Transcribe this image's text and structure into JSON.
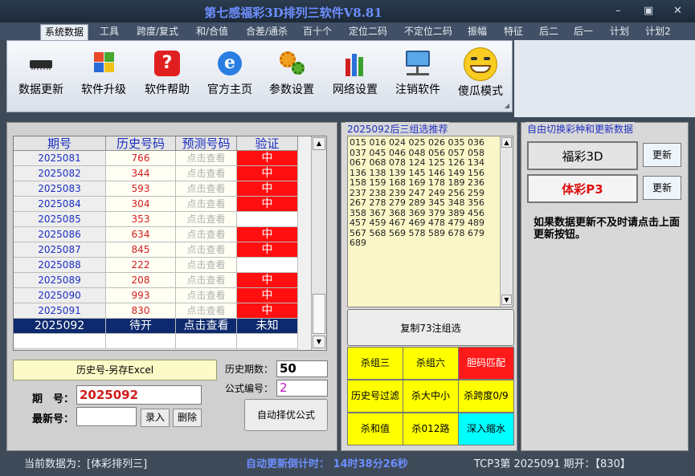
{
  "window": {
    "title": "第七感福彩3D排列三软件V8.81",
    "min_glyph": "–",
    "max_glyph": "▣",
    "close_glyph": "✕"
  },
  "menu": {
    "tabs": [
      "系统数据",
      "工具",
      "跨度/复式",
      "和/合值",
      "合差/通杀",
      "百十个",
      "定位二码",
      "不定位二码",
      "振幅",
      "特征",
      "后二",
      "后一",
      "计划",
      "计划2"
    ]
  },
  "toolbar": {
    "buttons": [
      "数据更新",
      "软件升级",
      "软件帮助",
      "官方主页",
      "参数设置",
      "网络设置",
      "注销软件",
      "傻瓜模式"
    ],
    "help_glyph": "?",
    "ie_glyph": "e"
  },
  "grid": {
    "headers": [
      "期号",
      "历史号码",
      "预测号码",
      "验证"
    ],
    "rows": [
      {
        "period": "2025081",
        "history": "766",
        "predict": "点击查看",
        "verify": "中"
      },
      {
        "period": "2025082",
        "history": "344",
        "predict": "点击查看",
        "verify": "中"
      },
      {
        "period": "2025083",
        "history": "593",
        "predict": "点击查看",
        "verify": "中"
      },
      {
        "period": "2025084",
        "history": "304",
        "predict": "点击查看",
        "verify": "中"
      },
      {
        "period": "2025085",
        "history": "353",
        "predict": "点击查看",
        "verify": ""
      },
      {
        "period": "2025086",
        "history": "634",
        "predict": "点击查看",
        "verify": "中"
      },
      {
        "period": "2025087",
        "history": "845",
        "predict": "点击查看",
        "verify": "中"
      },
      {
        "period": "2025088",
        "history": "222",
        "predict": "点击查看",
        "verify": ""
      },
      {
        "period": "2025089",
        "history": "208",
        "predict": "点击查看",
        "verify": "中"
      },
      {
        "period": "2025090",
        "history": "993",
        "predict": "点击查看",
        "verify": "中"
      },
      {
        "period": "2025091",
        "history": "830",
        "predict": "点击查看",
        "verify": "中"
      },
      {
        "period": "2025092",
        "history": "待开",
        "predict": "点击查看",
        "verify": "未知"
      }
    ]
  },
  "left": {
    "export_btn": "历史号-另存Excel",
    "period_label": "期　号：",
    "period_value": "2025092",
    "newest_label": "最新号：",
    "newest_value": "",
    "enter_btn": "录入",
    "delete_btn": "删除",
    "history_count_label": "历史期数：",
    "history_count_value": "50",
    "formula_label": "公式编号：",
    "formula_value": "2",
    "auto_btn": "自动择优公式"
  },
  "middle": {
    "title": "2025092后三组选推荐",
    "numbers": "015 016 024 025 026 035 036 037 045 046 048 056 057 058 067 068 078 124 125 126 134 136 138 139 145 146 149 156 158 159 168 169 178 189 236 237 238 239 247 249 256 259 267 278 279 289 345 348 356 358 367 368 369 379 389 456 457 459 467 469 478 479 489 567 568 569 578 589 678 679 689",
    "copy_btn": "复制73注组选",
    "buttons": [
      {
        "label": "杀组三",
        "color": "#ffff00",
        "text": "#000000"
      },
      {
        "label": "杀组六",
        "color": "#ffff00",
        "text": "#000000"
      },
      {
        "label": "胆码匹配",
        "color": "#ff1a1a",
        "text": "#ffffff"
      },
      {
        "label": "历史号过滤",
        "color": "#ffff00",
        "text": "#000000"
      },
      {
        "label": "杀大中小",
        "color": "#ffff00",
        "text": "#000000"
      },
      {
        "label": "杀跨度0/9",
        "color": "#ffff00",
        "text": "#000000"
      },
      {
        "label": "杀和值",
        "color": "#ffff00",
        "text": "#000000"
      },
      {
        "label": "杀012路",
        "color": "#ffff00",
        "text": "#000000"
      },
      {
        "label": "深入缩水",
        "color": "#00ffff",
        "text": "#000000"
      }
    ]
  },
  "right": {
    "title": "自由切换彩种和更新数据",
    "fc3d": "福彩3D",
    "p3": "体彩P3",
    "update": "更新",
    "note": "如果数据更新不及时请点击上面更新按钮。"
  },
  "status": {
    "current": "当前数据为：[体彩排列三]",
    "countdown": "自动更新倒计时： 14时38分26秒",
    "draw": "TCP3第 2025091 期开：【830】"
  },
  "colors": {
    "hit": "#ff0f0f",
    "row_blue": "#0e2a6e",
    "accent": "#2030c0"
  }
}
